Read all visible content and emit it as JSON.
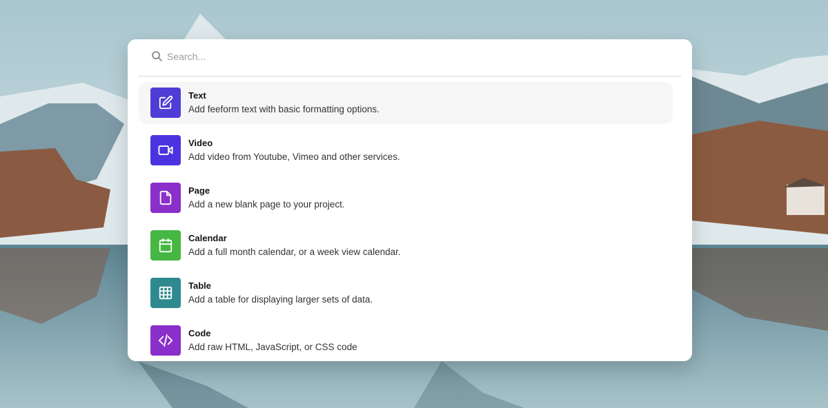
{
  "search": {
    "placeholder": "Search..."
  },
  "items": [
    {
      "title": "Text",
      "description": "Add feeform text with basic formatting options.",
      "color": "#4f3cd6",
      "icon": "edit-icon",
      "active": true
    },
    {
      "title": "Video",
      "description": "Add video from Youtube, Vimeo and other services.",
      "color": "#4b34e0",
      "icon": "video-camera-icon",
      "active": false
    },
    {
      "title": "Page",
      "description": "Add a new blank page to your project.",
      "color": "#8a2fc9",
      "icon": "document-icon",
      "active": false
    },
    {
      "title": "Calendar",
      "description": "Add a full month calendar, or a week view calendar.",
      "color": "#45b742",
      "icon": "calendar-icon",
      "active": false
    },
    {
      "title": "Table",
      "description": "Add a table for displaying larger sets of data.",
      "color": "#2f8a8f",
      "icon": "table-icon",
      "active": false
    },
    {
      "title": "Code",
      "description": "Add raw HTML, JavaScript, or CSS code",
      "color": "#8a2fc9",
      "icon": "code-icon",
      "active": false
    }
  ]
}
